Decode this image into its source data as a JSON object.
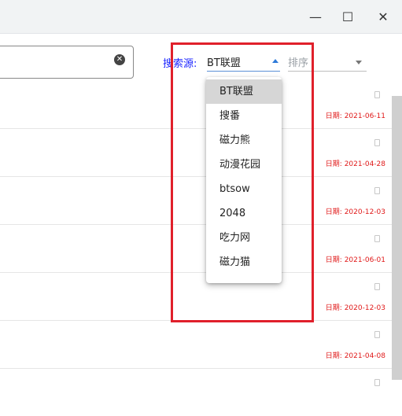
{
  "window": {
    "minimize_glyph": "—",
    "maximize_glyph": "☐",
    "close_glyph": "✕"
  },
  "search": {
    "value": "",
    "clear_icon": "clear-icon"
  },
  "source": {
    "label": "搜索源:",
    "selected": "BT联盟",
    "options": [
      "BT联盟",
      "搜番",
      "磁力熊",
      "动漫花园",
      "btsow",
      "2048",
      "吃力网",
      "磁力猫"
    ]
  },
  "sort": {
    "label": "排序"
  },
  "results": [
    {
      "date": "日期: 2021-06-11"
    },
    {
      "date": "日期: 2021-04-28"
    },
    {
      "date": "日期: 2020-12-03"
    },
    {
      "date": "日期: 2021-06-01"
    },
    {
      "date": "日期: 2020-12-03"
    },
    {
      "date": "日期: 2021-04-08"
    },
    {
      "date": ""
    }
  ],
  "colors": {
    "highlight": "#e0202b",
    "source_label": "#1a23ff",
    "date": "#e01919",
    "selected_option_bg": "#d6d6d6"
  }
}
